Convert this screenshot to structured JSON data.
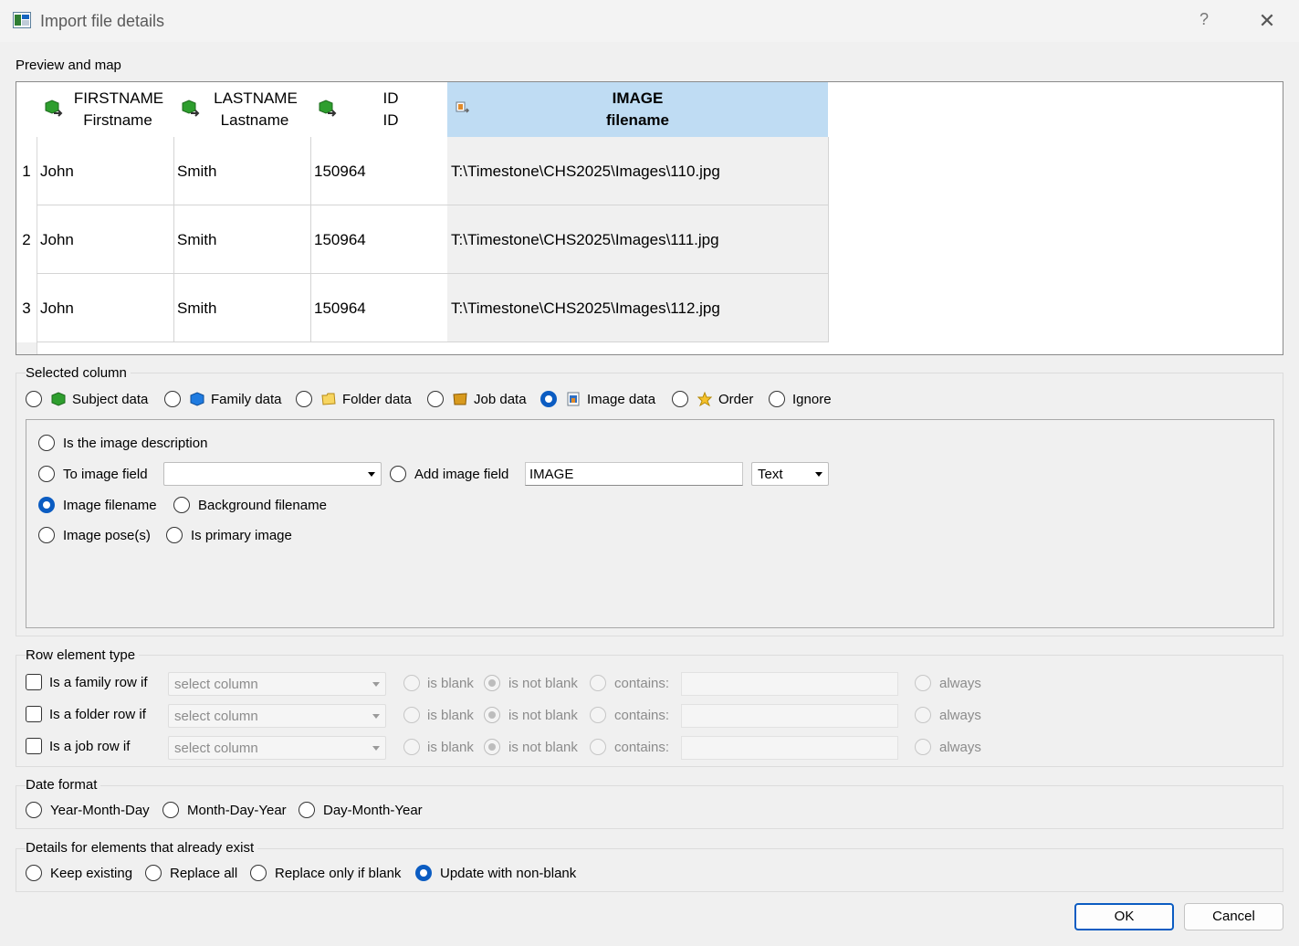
{
  "window": {
    "title": "Import file details",
    "help_glyph": "?",
    "close_glyph": "✕"
  },
  "preview": {
    "label": "Preview and map",
    "columns": [
      {
        "name": "FIRSTNAME",
        "sub": "Firstname",
        "icon": "subject-data-icon"
      },
      {
        "name": "LASTNAME",
        "sub": "Lastname",
        "icon": "subject-data-icon"
      },
      {
        "name": "ID",
        "sub": "ID",
        "icon": "subject-data-icon"
      },
      {
        "name": "IMAGE",
        "sub": "filename",
        "icon": "image-data-icon",
        "selected": true
      }
    ],
    "rows": [
      {
        "num": "1",
        "cells": [
          "John",
          "Smith",
          "150964",
          "T:\\Timestone\\CHS2025\\Images\\110.jpg"
        ]
      },
      {
        "num": "2",
        "cells": [
          "John",
          "Smith",
          "150964",
          "T:\\Timestone\\CHS2025\\Images\\111.jpg"
        ]
      },
      {
        "num": "3",
        "cells": [
          "John",
          "Smith",
          "150964",
          "T:\\Timestone\\CHS2025\\Images\\112.jpg"
        ]
      }
    ]
  },
  "selected_column": {
    "label": "Selected column",
    "options": [
      "Subject data",
      "Family data",
      "Folder data",
      "Job data",
      "Image data",
      "Order",
      "Ignore"
    ],
    "selected": "Image data",
    "image": {
      "is_description": "Is the image description",
      "to_image_field": "To image field",
      "to_image_field_value": "",
      "add_image_field": "Add image field",
      "add_image_field_value": "IMAGE",
      "type_value": "Text",
      "image_filename": "Image filename",
      "background_filename": "Background filename",
      "image_poses": "Image pose(s)",
      "is_primary": "Is primary image",
      "selected": "Image filename"
    }
  },
  "row_element_type": {
    "label": "Row element type",
    "rows": [
      {
        "label": "Is a family row if",
        "column": "select column",
        "is_blank": "is blank",
        "is_not_blank": "is not blank",
        "contains": "contains:",
        "always": "always"
      },
      {
        "label": "Is a folder row if",
        "column": "select column",
        "is_blank": "is blank",
        "is_not_blank": "is not blank",
        "contains": "contains:",
        "always": "always"
      },
      {
        "label": "Is a job row if",
        "column": "select column",
        "is_blank": "is blank",
        "is_not_blank": "is not blank",
        "contains": "contains:",
        "always": "always"
      }
    ]
  },
  "date_format": {
    "label": "Date format",
    "options": [
      "Year-Month-Day",
      "Month-Day-Year",
      "Day-Month-Year"
    ]
  },
  "existing_details": {
    "label": "Details for elements that already exist",
    "options": [
      "Keep existing",
      "Replace all",
      "Replace only if blank",
      "Update with non-blank"
    ],
    "selected": "Update with non-blank"
  },
  "buttons": {
    "ok": "OK",
    "cancel": "Cancel"
  },
  "colors": {
    "accent": "#0b5cc2",
    "selected_header": "#bfdcf3"
  }
}
